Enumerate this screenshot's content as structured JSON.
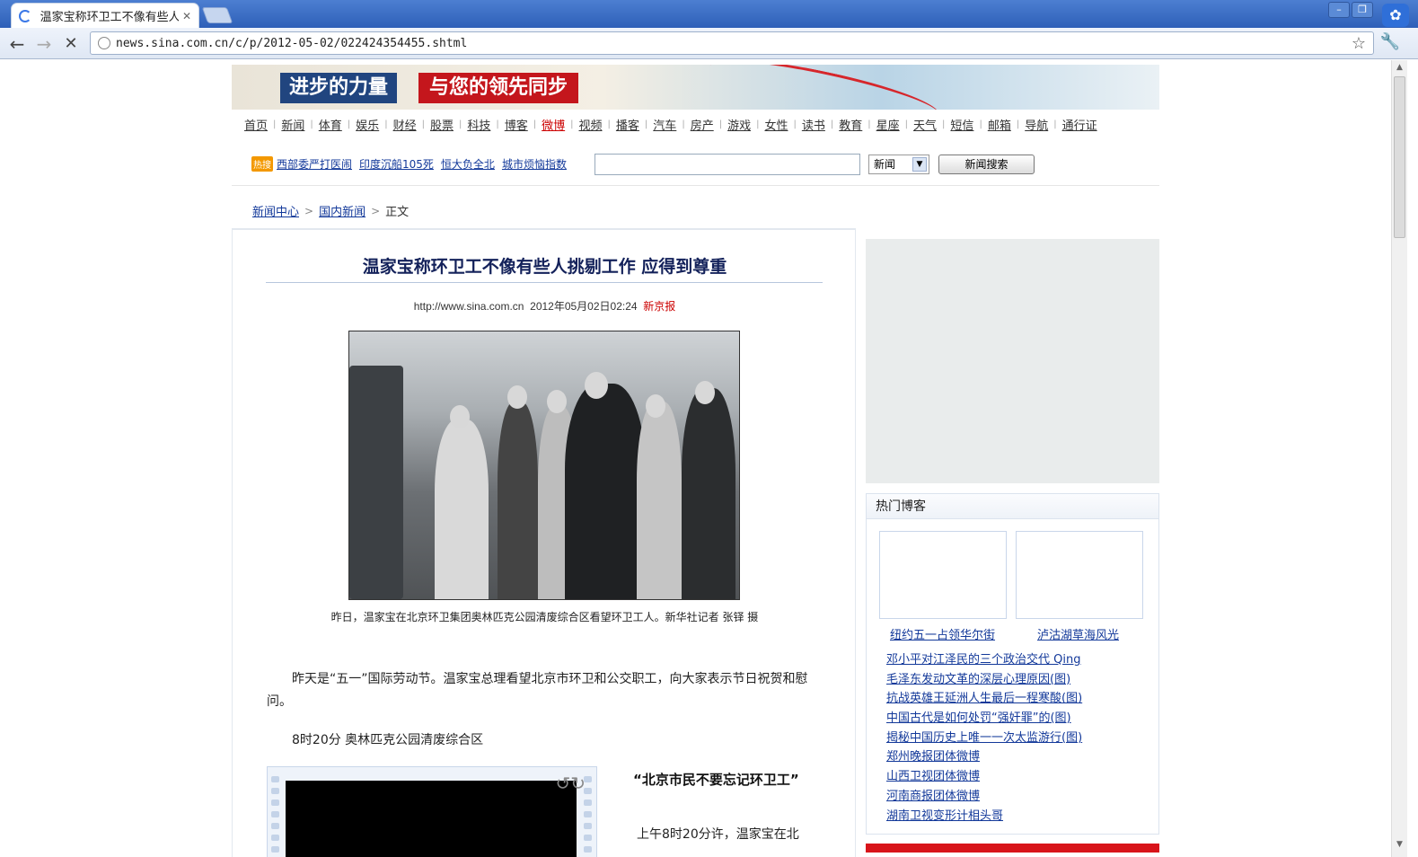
{
  "browser": {
    "tab_title": "温家宝称环卫工不像有些人",
    "url": "news.sina.com.cn/c/p/2012-05-02/022424354455.shtml"
  },
  "banner": {
    "left_text": "进步的力量",
    "right_text": "与您的领先同步"
  },
  "channel_nav": [
    "首页",
    "新闻",
    "体育",
    "娱乐",
    "财经",
    "股票",
    "科技",
    "博客",
    "微博",
    "视频",
    "播客",
    "汽车",
    "房产",
    "游戏",
    "女性",
    "读书",
    "教育",
    "星座",
    "天气",
    "短信",
    "邮箱",
    "导航",
    "通行证"
  ],
  "hot_links": {
    "badge": "热搜",
    "items": [
      "西部委严打医闹",
      "印度沉船105死",
      "恒大负全北",
      "城市烦恼指数"
    ]
  },
  "search": {
    "select_value": "新闻",
    "button_label": "新闻搜索"
  },
  "breadcrumb": {
    "root": "新闻中心",
    "section": "国内新闻",
    "current": "正文"
  },
  "article": {
    "title": "温家宝称环卫工不像有些人挑剔工作 应得到尊重",
    "site": "http://www.sina.com.cn",
    "datetime": "2012年05月02日02:24",
    "source": "新京报",
    "caption": "昨日，温家宝在北京环卫集团奥林匹克公园清废综合区看望环卫工人。新华社记者 张铎 摄",
    "para1": "昨天是“五一”国际劳动节。温家宝总理看望北京市环卫和公交职工，向大家表示节日祝贺和慰问。",
    "para2": "8时20分 奥林匹克公园清废综合区",
    "subhead": "“北京市民不要忘记环卫工”",
    "para3": "上午8时20分许，温家宝在北"
  },
  "sidebar": {
    "blog_title": "热门博客",
    "thumb_captions": [
      "纽约五一占领华尔街",
      "泸沽湖草海风光"
    ],
    "blog_links": [
      "邓小平对江泽民的三个政治交代 Qing",
      "毛泽东发动文革的深层心理原因(图)",
      "抗战英雄王延洲人生最后一程寒酸(图)",
      "中国古代是如何处罚“强奸罪”的(图)",
      "揭秘中国历史上唯一一次太监游行(图)",
      "郑州晚报团体微博",
      "山西卫视团体微博",
      "河南商报团体微博",
      "湖南卫视变形计相头哥"
    ]
  },
  "colors": {
    "link": "#13399a",
    "headline": "#13215a",
    "source_red": "#cc0000",
    "chrome_blue": "#2e5fb8"
  }
}
